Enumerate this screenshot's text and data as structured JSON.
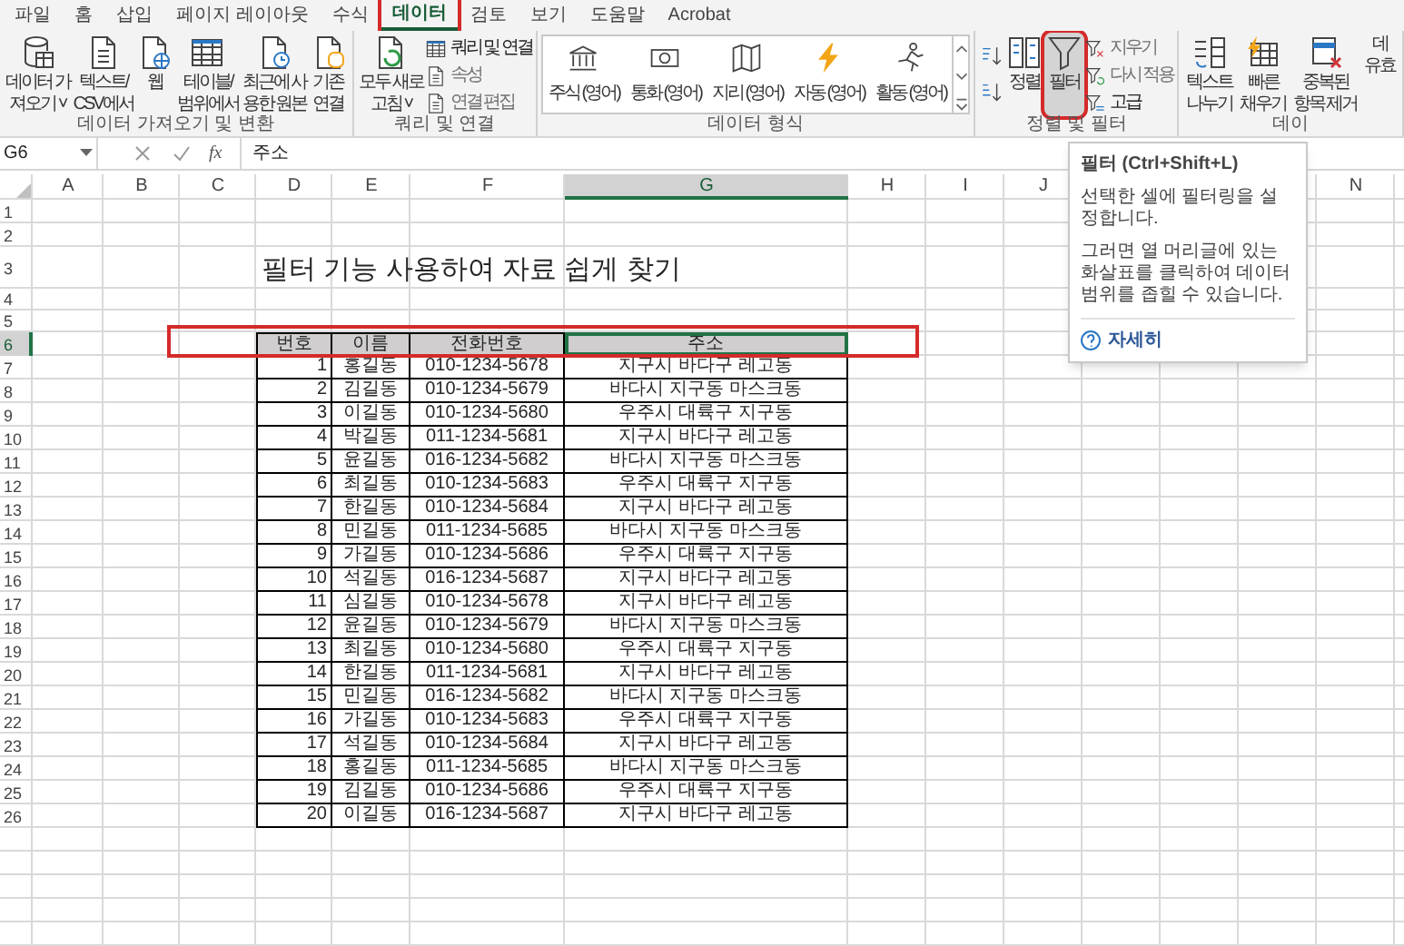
{
  "ribbon_tabs": [
    {
      "label": "파일",
      "selected": false,
      "highlighted": false
    },
    {
      "label": "홈",
      "selected": false,
      "highlighted": false
    },
    {
      "label": "삽입",
      "selected": false,
      "highlighted": false
    },
    {
      "label": "페이지 레이아웃",
      "selected": false,
      "highlighted": false
    },
    {
      "label": "수식",
      "selected": false,
      "highlighted": false
    },
    {
      "label": "데이터",
      "selected": true,
      "highlighted": true
    },
    {
      "label": "검토",
      "selected": false,
      "highlighted": false
    },
    {
      "label": "보기",
      "selected": false,
      "highlighted": false
    },
    {
      "label": "도움말",
      "selected": false,
      "highlighted": false
    },
    {
      "label": "Acrobat",
      "selected": false,
      "highlighted": false
    }
  ],
  "ribbon_groups": [
    {
      "label": "데이터 가져오기 및 변환",
      "buttons": [
        {
          "kind": "large",
          "lines": [
            "데이터 가",
            "져오기 ˅"
          ],
          "pressed": false,
          "highlighted": false
        },
        {
          "kind": "large",
          "lines": [
            "텍스트/",
            "CSV에서"
          ],
          "pressed": false,
          "highlighted": false
        },
        {
          "kind": "large",
          "lines": [
            "웹"
          ],
          "pressed": false,
          "highlighted": false
        },
        {
          "kind": "large",
          "lines": [
            "테이블/",
            "범위에서"
          ],
          "pressed": false,
          "highlighted": false
        },
        {
          "kind": "large",
          "lines": [
            "최근에 사",
            "용한 원본"
          ],
          "pressed": false,
          "highlighted": false
        },
        {
          "kind": "large",
          "lines": [
            "기존",
            "연결"
          ],
          "pressed": false,
          "highlighted": false
        }
      ]
    },
    {
      "label": "쿼리 및 연결",
      "buttons": [
        {
          "kind": "large",
          "lines": [
            "모두 새로",
            "고침 ˅"
          ],
          "pressed": false,
          "highlighted": false
        },
        {
          "kind": "stack",
          "items": [
            {
              "label": "쿼리 및 연결",
              "disabled": false
            },
            {
              "label": "속성",
              "disabled": true
            },
            {
              "label": "연결 편집",
              "disabled": true
            }
          ]
        }
      ]
    },
    {
      "label": "데이터 형식",
      "buttons": [
        {
          "kind": "gallery",
          "items": [
            "주식 (영어)",
            "통화 (영어)",
            "지리 (영어)",
            "자동 (영어)",
            "활동 (영어)"
          ]
        }
      ]
    },
    {
      "label": "정렬 및 필터",
      "buttons": [
        {
          "kind": "sort"
        },
        {
          "kind": "large",
          "lines": [
            "정렬"
          ],
          "pressed": false,
          "highlighted": false
        },
        {
          "kind": "large",
          "lines": [
            "필터"
          ],
          "pressed": true,
          "highlighted": true
        },
        {
          "kind": "stack",
          "items": [
            {
              "label": "지우기",
              "disabled": true
            },
            {
              "label": "다시 적용",
              "disabled": true
            },
            {
              "label": "고급",
              "disabled": false
            }
          ]
        }
      ]
    },
    {
      "label": "데이",
      "buttons": [
        {
          "kind": "large",
          "lines": [
            "텍스트",
            "나누기"
          ],
          "pressed": false,
          "highlighted": false
        },
        {
          "kind": "large",
          "lines": [
            "빠른",
            "채우기"
          ],
          "pressed": false,
          "highlighted": false
        },
        {
          "kind": "large",
          "lines": [
            "중복된",
            "항목 제거"
          ],
          "pressed": false,
          "highlighted": false
        },
        {
          "kind": "large",
          "lines": [
            "데",
            "유효"
          ],
          "pressed": false,
          "highlighted": false
        }
      ]
    }
  ],
  "formula_bar": {
    "name_box": "G6",
    "function_label": "fx",
    "content": "주소"
  },
  "sheet": {
    "columns": [
      {
        "label": "A",
        "selected": false
      },
      {
        "label": "B",
        "selected": false
      },
      {
        "label": "C",
        "selected": false
      },
      {
        "label": "D",
        "selected": false
      },
      {
        "label": "E",
        "selected": false
      },
      {
        "label": "F",
        "selected": false
      },
      {
        "label": "G",
        "selected": true
      },
      {
        "label": "H",
        "selected": false
      },
      {
        "label": "I",
        "selected": false
      },
      {
        "label": "J",
        "selected": false
      },
      {
        "label": "N",
        "selected": false
      }
    ],
    "rows": [
      {
        "label": "1",
        "selected": false
      },
      {
        "label": "2",
        "selected": false
      },
      {
        "label": "3",
        "selected": false
      },
      {
        "label": "4",
        "selected": false
      },
      {
        "label": "5",
        "selected": false
      },
      {
        "label": "6",
        "selected": true
      },
      {
        "label": "7",
        "selected": false
      },
      {
        "label": "8",
        "selected": false
      },
      {
        "label": "9",
        "selected": false
      },
      {
        "label": "10",
        "selected": false
      },
      {
        "label": "11",
        "selected": false
      },
      {
        "label": "12",
        "selected": false
      },
      {
        "label": "13",
        "selected": false
      },
      {
        "label": "14",
        "selected": false
      },
      {
        "label": "15",
        "selected": false
      },
      {
        "label": "16",
        "selected": false
      },
      {
        "label": "17",
        "selected": false
      },
      {
        "label": "18",
        "selected": false
      },
      {
        "label": "19",
        "selected": false
      },
      {
        "label": "20",
        "selected": false
      },
      {
        "label": "21",
        "selected": false
      },
      {
        "label": "22",
        "selected": false
      },
      {
        "label": "23",
        "selected": false
      },
      {
        "label": "24",
        "selected": false
      },
      {
        "label": "25",
        "selected": false
      },
      {
        "label": "26",
        "selected": false
      }
    ],
    "title": "필터 기능 사용하여 자료 쉽게 찾기",
    "table": {
      "highlighted": true,
      "columns": [
        {
          "label": "번호",
          "selected": false
        },
        {
          "label": "이름",
          "selected": false
        },
        {
          "label": "전화번호",
          "selected": false
        },
        {
          "label": "주소",
          "selected": true
        }
      ],
      "rows": [
        [
          "1",
          "홍길동",
          "010-1234-5678",
          "지구시 바다구 레고동"
        ],
        [
          "2",
          "김길동",
          "010-1234-5679",
          "바다시 지구동 마스크동"
        ],
        [
          "3",
          "이길동",
          "010-1234-5680",
          "우주시 대륙구 지구동"
        ],
        [
          "4",
          "박길동",
          "011-1234-5681",
          "지구시 바다구 레고동"
        ],
        [
          "5",
          "윤길동",
          "016-1234-5682",
          "바다시 지구동 마스크동"
        ],
        [
          "6",
          "최길동",
          "010-1234-5683",
          "우주시 대륙구 지구동"
        ],
        [
          "7",
          "한길동",
          "010-1234-5684",
          "지구시 바다구 레고동"
        ],
        [
          "8",
          "민길동",
          "011-1234-5685",
          "바다시 지구동 마스크동"
        ],
        [
          "9",
          "가길동",
          "010-1234-5686",
          "우주시 대륙구 지구동"
        ],
        [
          "10",
          "석길동",
          "016-1234-5687",
          "지구시 바다구 레고동"
        ],
        [
          "11",
          "심길동",
          "010-1234-5678",
          "지구시 바다구 레고동"
        ],
        [
          "12",
          "윤길동",
          "010-1234-5679",
          "바다시 지구동 마스크동"
        ],
        [
          "13",
          "최길동",
          "010-1234-5680",
          "우주시 대륙구 지구동"
        ],
        [
          "14",
          "한길동",
          "011-1234-5681",
          "지구시 바다구 레고동"
        ],
        [
          "15",
          "민길동",
          "016-1234-5682",
          "바다시 지구동 마스크동"
        ],
        [
          "16",
          "가길동",
          "010-1234-5683",
          "우주시 대륙구 지구동"
        ],
        [
          "17",
          "석길동",
          "010-1234-5684",
          "지구시 바다구 레고동"
        ],
        [
          "18",
          "홍길동",
          "011-1234-5685",
          "바다시 지구동 마스크동"
        ],
        [
          "19",
          "김길동",
          "010-1234-5686",
          "우주시 대륙구 지구동"
        ],
        [
          "20",
          "이길동",
          "016-1234-5687",
          "지구시 바다구 레고동"
        ]
      ]
    }
  },
  "tooltip": {
    "title": "필터 (Ctrl+Shift+L)",
    "paragraphs": [
      "선택한 셀에 필터링을 설정합니다.",
      "그러면 열 머리글에 있는 화살표를 클릭하여 데이터 범위를 좁힐 수 있습니다."
    ],
    "link": "자세히"
  }
}
